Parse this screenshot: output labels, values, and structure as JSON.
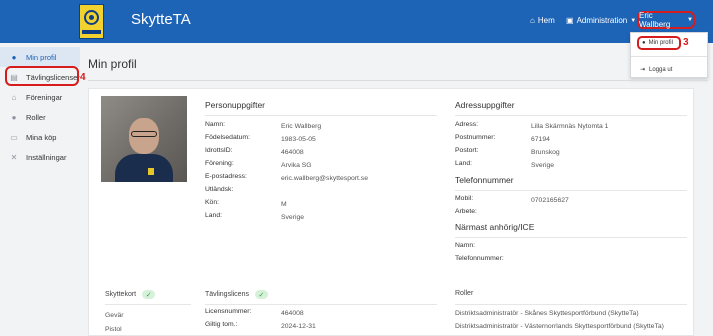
{
  "header": {
    "app_title": "SkytteTA",
    "nav": {
      "home": "Hem",
      "admin": "Administration",
      "user": "Eric Wallberg"
    },
    "dropdown": {
      "profile": "Min profil",
      "logout": "Logga ut"
    },
    "annotations": {
      "profile_number": "3",
      "license_number": "4"
    }
  },
  "sidebar": {
    "items": [
      {
        "label": "Min profil",
        "icon": "user-icon"
      },
      {
        "label": "Tävlingslicenser",
        "icon": "id-card-icon"
      },
      {
        "label": "Föreningar",
        "icon": "house-icon"
      },
      {
        "label": "Roller",
        "icon": "users-icon"
      },
      {
        "label": "Mina köp",
        "icon": "cart-icon"
      },
      {
        "label": "Inställningar",
        "icon": "tools-icon"
      }
    ]
  },
  "page": {
    "title": "Min profil"
  },
  "personal": {
    "title": "Personuppgifter",
    "fields": [
      {
        "label": "Namn:",
        "value": "Eric Wallberg"
      },
      {
        "label": "Födelsedatum:",
        "value": "1983-05-05"
      },
      {
        "label": "IdrottsID:",
        "value": "464008"
      },
      {
        "label": "Förening:",
        "value": "Arvika SG"
      },
      {
        "label": "E-postadress:",
        "value": "eric.wallberg@skyttesport.se"
      },
      {
        "label": "Utländsk:",
        "value": ""
      },
      {
        "label": "Kön:",
        "value": "M"
      },
      {
        "label": "Land:",
        "value": "Sverige"
      }
    ]
  },
  "address": {
    "title": "Adressuppgifter",
    "fields": [
      {
        "label": "Adress:",
        "value": "Lilla Skärmnäs Nytomta 1"
      },
      {
        "label": "Postnummer:",
        "value": "67194"
      },
      {
        "label": "Postort:",
        "value": "Brunskog"
      },
      {
        "label": "Land:",
        "value": "Sverige"
      }
    ]
  },
  "phone": {
    "title": "Telefonnummer",
    "fields": [
      {
        "label": "Mobil:",
        "value": "0702165627"
      },
      {
        "label": "Arbete:",
        "value": ""
      }
    ]
  },
  "ice": {
    "title": "Närmast anhörig/ICE",
    "fields": [
      {
        "label": "Namn:",
        "value": ""
      },
      {
        "label": "Telefonnummer:",
        "value": ""
      }
    ]
  },
  "shooting_card": {
    "title": "Skyttekort",
    "items": [
      "Gevär",
      "Pistol"
    ]
  },
  "license": {
    "title": "Tävlingslicens",
    "fields": [
      {
        "label": "Licensnummer:",
        "value": "464008"
      },
      {
        "label": "Giltig tom.:",
        "value": "2024-12-31"
      }
    ]
  },
  "roles": {
    "title": "Roller",
    "items": [
      "Distriktsadministratör - Skånes Skyttesportförbund (SkytteTa)",
      "Distriktsadministratör - Västernorrlands Skyttesportförbund (SkytteTa)"
    ]
  }
}
